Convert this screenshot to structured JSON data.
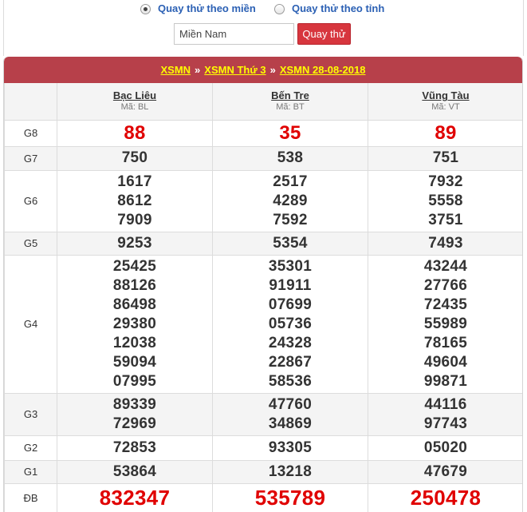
{
  "filter": {
    "options": [
      {
        "label": "Quay thử theo miền",
        "checked": true
      },
      {
        "label": "Quay thử theo tỉnh",
        "checked": false
      }
    ],
    "input_value": "Miền Nam",
    "button_label": "Quay thử"
  },
  "breadcrumb": {
    "items": [
      "XSMN",
      "XSMN Thứ 3",
      "XSMN 28-08-2018"
    ],
    "separator": "»"
  },
  "provinces": [
    {
      "name": "Bạc Liêu",
      "code": "Mã: BL"
    },
    {
      "name": "Bến Tre",
      "code": "Mã: BT"
    },
    {
      "name": "Vũng Tàu",
      "code": "Mã: VT"
    }
  ],
  "prizes": [
    {
      "label": "G8",
      "style": "red",
      "values": [
        [
          "88"
        ],
        [
          "35"
        ],
        [
          "89"
        ]
      ]
    },
    {
      "label": "G7",
      "style": "normal",
      "values": [
        [
          "750"
        ],
        [
          "538"
        ],
        [
          "751"
        ]
      ]
    },
    {
      "label": "G6",
      "style": "normal",
      "values": [
        [
          "1617",
          "8612",
          "7909"
        ],
        [
          "2517",
          "4289",
          "7592"
        ],
        [
          "7932",
          "5558",
          "3751"
        ]
      ]
    },
    {
      "label": "G5",
      "style": "normal",
      "values": [
        [
          "9253"
        ],
        [
          "5354"
        ],
        [
          "7493"
        ]
      ]
    },
    {
      "label": "G4",
      "style": "normal",
      "values": [
        [
          "25425",
          "88126",
          "86498",
          "29380",
          "12038",
          "59094",
          "07995"
        ],
        [
          "35301",
          "91911",
          "07699",
          "05736",
          "24328",
          "22867",
          "58536"
        ],
        [
          "43244",
          "27766",
          "72435",
          "55989",
          "78165",
          "49604",
          "99871"
        ]
      ]
    },
    {
      "label": "G3",
      "style": "normal",
      "values": [
        [
          "89339",
          "72969"
        ],
        [
          "47760",
          "34869"
        ],
        [
          "44116",
          "97743"
        ]
      ]
    },
    {
      "label": "G2",
      "style": "normal",
      "values": [
        [
          "72853"
        ],
        [
          "93305"
        ],
        [
          "05020"
        ]
      ]
    },
    {
      "label": "G1",
      "style": "normal",
      "values": [
        [
          "53864"
        ],
        [
          "13218"
        ],
        [
          "47679"
        ]
      ]
    },
    {
      "label": "ĐB",
      "style": "big",
      "values": [
        [
          "832347"
        ],
        [
          "535789"
        ],
        [
          "250478"
        ]
      ]
    }
  ],
  "colors": {
    "title_bar": "#b7404a",
    "breadcrumb_link": "#ffff00",
    "button": "#d7363e",
    "special_number": "#e00000",
    "radio_label": "#2b60b4"
  }
}
